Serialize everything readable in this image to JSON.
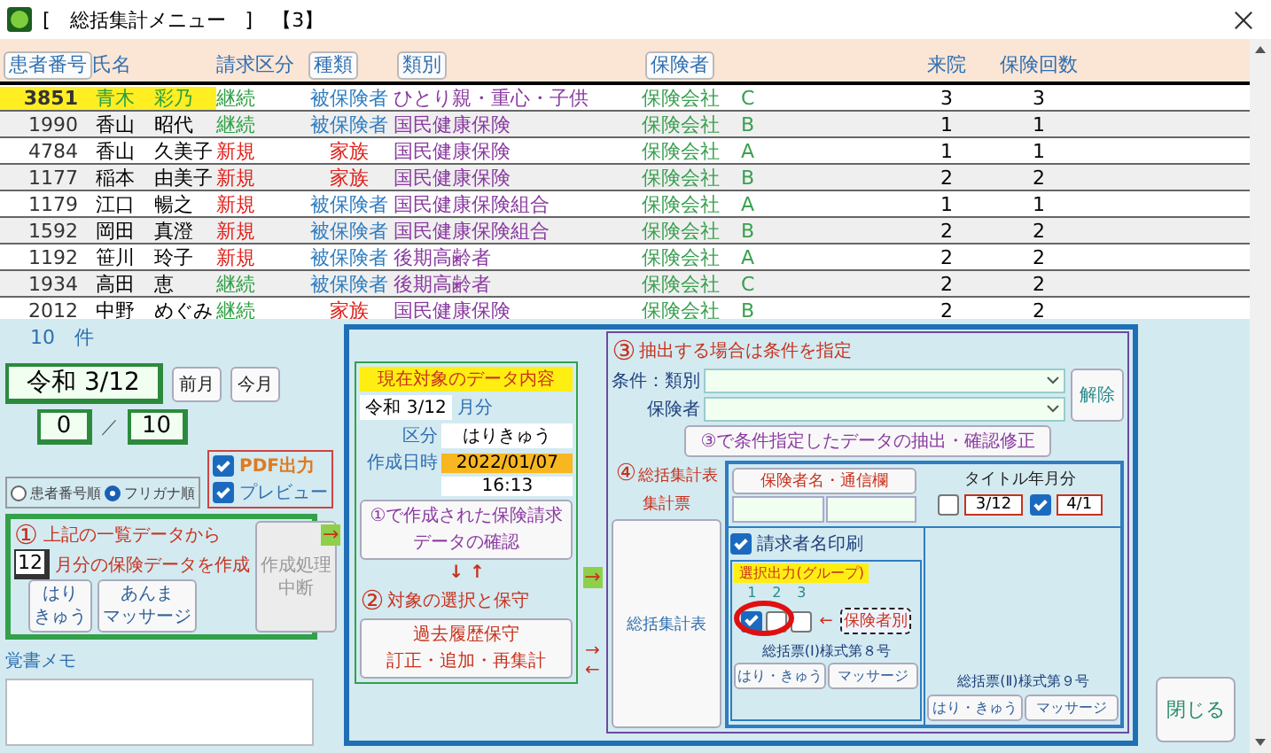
{
  "window": {
    "title": "[　総括集計メニュー　]　【3】"
  },
  "table": {
    "columns": [
      {
        "label": "患者番号",
        "kind": "button"
      },
      {
        "label": "氏名",
        "kind": "plain"
      },
      {
        "label": "請求区分",
        "kind": "plain"
      },
      {
        "label": "種類",
        "kind": "button"
      },
      {
        "label": "類別",
        "kind": "button"
      },
      {
        "label": "保険者",
        "kind": "button"
      },
      {
        "label": "来院",
        "kind": "plain"
      },
      {
        "label": "保険回数",
        "kind": "plain"
      }
    ],
    "rows": [
      {
        "selected": true,
        "no": "3851",
        "name": "青木　彩乃",
        "claim": {
          "text": "継続",
          "color": "#2ea043"
        },
        "type": {
          "text": "被保険者",
          "color": "#2f7dc0"
        },
        "category": "ひとり親・重心・子供",
        "insurer": "保険会社",
        "group": "C",
        "visits": "3",
        "count": "3"
      },
      {
        "selected": false,
        "no": "1990",
        "name": "香山　昭代",
        "claim": {
          "text": "継続",
          "color": "#2ea043"
        },
        "type": {
          "text": "被保険者",
          "color": "#2f7dc0"
        },
        "category": "国民健康保険",
        "insurer": "保険会社",
        "group": "B",
        "visits": "1",
        "count": "1"
      },
      {
        "selected": false,
        "no": "4784",
        "name": "香山　久美子",
        "claim": {
          "text": "新規",
          "color": "#e0201b"
        },
        "type": {
          "text": "家族",
          "color": "#e0201b"
        },
        "category": "国民健康保険",
        "insurer": "保険会社",
        "group": "A",
        "visits": "1",
        "count": "1"
      },
      {
        "selected": false,
        "no": "1177",
        "name": "稲本　由美子",
        "claim": {
          "text": "新規",
          "color": "#e0201b"
        },
        "type": {
          "text": "家族",
          "color": "#e0201b"
        },
        "category": "国民健康保険",
        "insurer": "保険会社",
        "group": "B",
        "visits": "2",
        "count": "2"
      },
      {
        "selected": false,
        "no": "1179",
        "name": "江口　暢之",
        "claim": {
          "text": "新規",
          "color": "#e0201b"
        },
        "type": {
          "text": "被保険者",
          "color": "#2f7dc0"
        },
        "category": "国民健康保険組合",
        "insurer": "保険会社",
        "group": "A",
        "visits": "1",
        "count": "1"
      },
      {
        "selected": false,
        "no": "1592",
        "name": "岡田　真澄",
        "claim": {
          "text": "新規",
          "color": "#e0201b"
        },
        "type": {
          "text": "被保険者",
          "color": "#2f7dc0"
        },
        "category": "国民健康保険組合",
        "insurer": "保険会社",
        "group": "B",
        "visits": "2",
        "count": "2"
      },
      {
        "selected": false,
        "no": "1192",
        "name": "笹川　玲子",
        "claim": {
          "text": "新規",
          "color": "#e0201b"
        },
        "type": {
          "text": "被保険者",
          "color": "#2f7dc0"
        },
        "category": "後期高齢者",
        "insurer": "保険会社",
        "group": "A",
        "visits": "2",
        "count": "2"
      },
      {
        "selected": false,
        "no": "1934",
        "name": "高田　恵",
        "claim": {
          "text": "継続",
          "color": "#2ea043"
        },
        "type": {
          "text": "被保険者",
          "color": "#2f7dc0"
        },
        "category": "後期高齢者",
        "insurer": "保険会社",
        "group": "C",
        "visits": "2",
        "count": "2"
      },
      {
        "selected": false,
        "no": "2012",
        "name": "中野　めぐみ",
        "claim": {
          "text": "継続",
          "color": "#2ea043"
        },
        "type": {
          "text": "家族",
          "color": "#e0201b"
        },
        "category": "国民健康保険",
        "insurer": "保険会社",
        "group": "B",
        "visits": "2",
        "count": "2"
      }
    ]
  },
  "record_count": "10　件",
  "period": {
    "date": "令和 3/12",
    "prev_button": "前月",
    "this_button": "今月",
    "progress": "0",
    "separator": "／",
    "total": "10"
  },
  "sort": [
    {
      "label": "患者番号順",
      "selected": false
    },
    {
      "label": "フリガナ順",
      "selected": true
    }
  ],
  "output_options": [
    {
      "label": "PDF出力",
      "checked": true
    },
    {
      "label": "プレビュー",
      "checked": true
    }
  ],
  "step1": {
    "number": "①",
    "title": "上記の一覧データから",
    "month": "12",
    "subtitle": "月分の保険データを作成",
    "buttons": [
      {
        "lines": [
          "はり",
          "きゅう"
        ],
        "disabled": false
      },
      {
        "lines": [
          "あんま",
          "マッサージ"
        ],
        "disabled": false
      },
      {
        "lines": [
          "作成処理",
          "中断"
        ],
        "disabled": true
      }
    ]
  },
  "flow_arrows": [
    "→",
    "→"
  ],
  "memo": {
    "label": "覚書メモ"
  },
  "current": {
    "title": "現在対象のデータ内容",
    "date": "令和 3/12",
    "date_unit": "月分",
    "kind_label": "区分",
    "kind_value": "はりきゅう",
    "created_label": "作成日時",
    "created_date": "2022/01/07",
    "created_time": "16:13",
    "confirm_button": [
      "①で作成された保険請求",
      "データの確認"
    ],
    "arrows": "↓ ↑"
  },
  "step2": {
    "number": "②",
    "title": "対象の選択と保守",
    "button": [
      "過去履歴保守",
      "訂正・追加・再集計"
    ]
  },
  "return_arrows": [
    "→",
    "←"
  ],
  "step3": {
    "number": "③",
    "title": "抽出する場合は条件を指定",
    "condition_label": "条件：類別",
    "insurer_label": "保険者",
    "clear_button": "解除",
    "extract_button": "③で条件指定したデータの抽出・確認修正"
  },
  "step4": {
    "number": "④",
    "title": "総括集計表",
    "subtitle": "集計票",
    "summary_button": "総括集計表",
    "note_header": "保険者名・通信欄",
    "title_period_label": "タイトル年月分",
    "title_periods": [
      {
        "label": "3/12",
        "checked": false
      },
      {
        "label": "4/1",
        "checked": true
      }
    ],
    "print_claimant": {
      "label": "請求者名印刷",
      "checked": true
    },
    "group_title": "選択出力(グループ)",
    "groups": [
      {
        "number": "1",
        "checked": true
      },
      {
        "number": "2",
        "checked": false
      },
      {
        "number": "3",
        "checked": false
      }
    ],
    "group_arrow": "←",
    "by_insurer_button": "保険者別",
    "forms": [
      {
        "title": "総括票(Ⅰ)様式第８号",
        "buttons": [
          "はり・きゅう",
          "マッサージ"
        ]
      },
      {
        "title": "総括票(Ⅱ)様式第９号",
        "buttons": [
          "はり・きゅう",
          "マッサージ"
        ]
      }
    ]
  },
  "close_button": "閉じる"
}
